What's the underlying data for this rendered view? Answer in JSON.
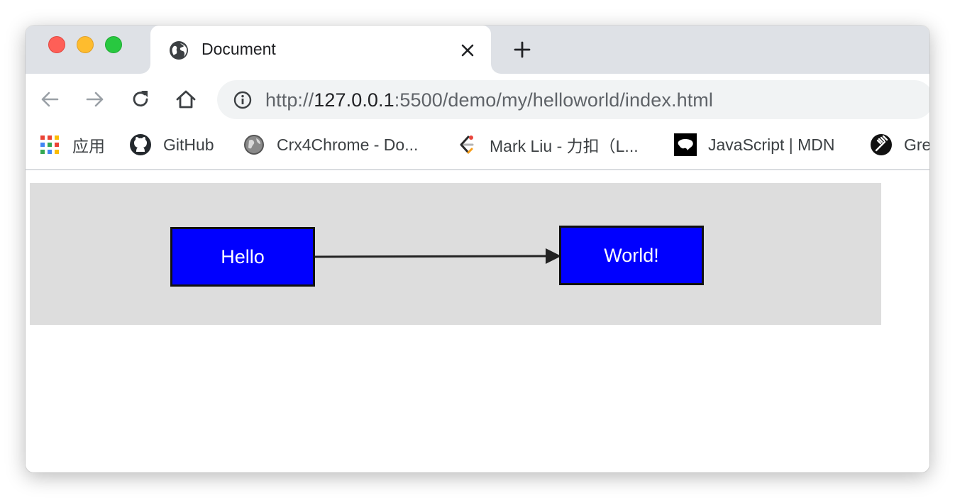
{
  "tab": {
    "title": "Document",
    "icon": "globe-icon"
  },
  "address_bar": {
    "url_scheme": "http://",
    "url_host": "127.0.0.1",
    "url_rest": ":5500/demo/my/helloworld/index.html"
  },
  "bookmarks": [
    {
      "label": "应用",
      "icon": "apps-grid-icon"
    },
    {
      "label": "GitHub",
      "icon": "github-icon"
    },
    {
      "label": "Crx4Chrome - Do...",
      "icon": "crx4chrome-icon"
    },
    {
      "label": "Mark Liu - 力扣（L...",
      "icon": "leetcode-icon"
    },
    {
      "label": "JavaScript | MDN",
      "icon": "mdn-icon"
    },
    {
      "label": "Gre",
      "icon": "greasyfork-icon"
    }
  ],
  "diagram": {
    "nodes": [
      {
        "id": "hello",
        "label": "Hello"
      },
      {
        "id": "world",
        "label": "World!"
      }
    ],
    "edges": [
      {
        "from": "hello",
        "to": "world"
      }
    ],
    "colors": {
      "background": "#dddddd",
      "node_fill": "#0000ff",
      "node_border": "#111111",
      "node_text": "#ffffff",
      "edge": "#222222"
    }
  }
}
